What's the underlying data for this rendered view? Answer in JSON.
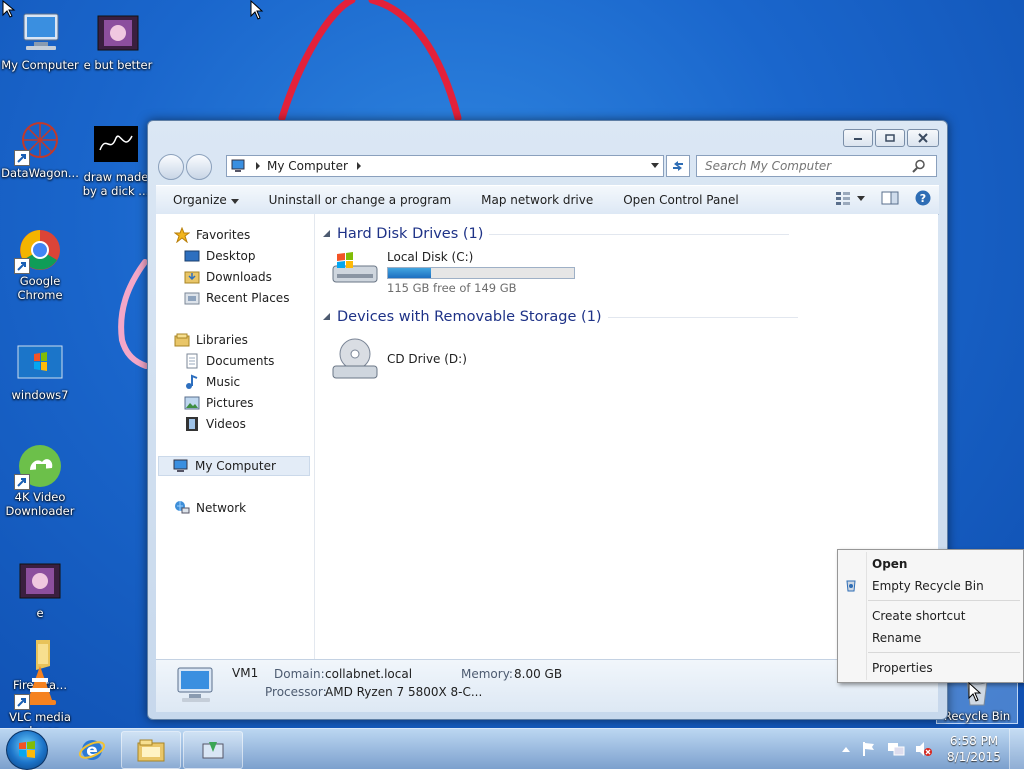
{
  "desktop": {
    "icons": [
      {
        "label": "My Computer"
      },
      {
        "label": "e but better"
      },
      {
        "label": "DataWagon..."
      },
      {
        "label": "draw made by a dick ..."
      },
      {
        "label": "Google Chrome"
      },
      {
        "label": "windows7"
      },
      {
        "label": "4K Video Downloader"
      },
      {
        "label": "e"
      },
      {
        "label": "Fire...ta..."
      },
      {
        "label": "VLC media player"
      },
      {
        "label": "Recycle Bin"
      }
    ]
  },
  "explorer": {
    "address": {
      "path": "My Computer"
    },
    "search": {
      "placeholder": "Search My Computer"
    },
    "toolbar": {
      "organize": "Organize",
      "uninstall": "Uninstall or change a program",
      "map_drive": "Map network drive",
      "control_panel": "Open Control Panel"
    },
    "nav": {
      "favorites": "Favorites",
      "desktop": "Desktop",
      "downloads": "Downloads",
      "recent": "Recent Places",
      "libraries": "Libraries",
      "documents": "Documents",
      "music": "Music",
      "pictures": "Pictures",
      "videos": "Videos",
      "my_computer": "My Computer",
      "network": "Network"
    },
    "groups": {
      "hdd": "Hard Disk Drives (1)",
      "removable": "Devices with Removable Storage (1)"
    },
    "drives": {
      "c": {
        "name": "Local Disk (C:)",
        "free_text": "115 GB free of 149 GB",
        "used_fraction": 0.23
      },
      "d": {
        "name": "CD Drive (D:)"
      }
    },
    "details": {
      "computer_name": "VM1",
      "domain_label": "Domain:",
      "domain_value": "collabnet.local",
      "memory_label": "Memory:",
      "memory_value": "8.00 GB",
      "processor_label": "Processor:",
      "processor_value": "AMD Ryzen 7 5800X 8-C..."
    }
  },
  "context_menu": {
    "open": "Open",
    "empty": "Empty Recycle Bin",
    "create_shortcut": "Create shortcut",
    "rename": "Rename",
    "properties": "Properties"
  },
  "taskbar": {
    "time": "6:58 PM",
    "date": "8/1/2015"
  },
  "colors": {
    "desktop": "#1a66cc",
    "group_header": "#1e3287",
    "scribble": "#e3213a",
    "disk_bar": "#1d6fc0"
  }
}
